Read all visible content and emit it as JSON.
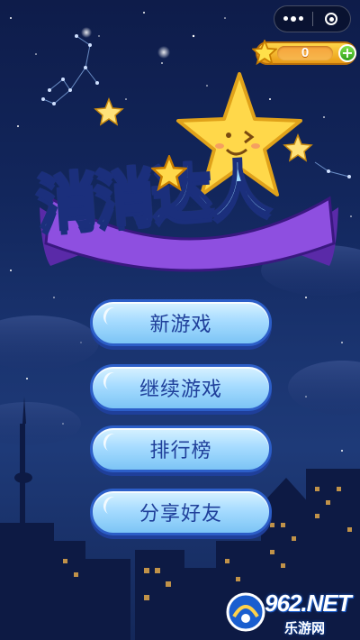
{
  "capsule": {
    "more_icon": "more-dots-icon",
    "close_icon": "close-circle-icon"
  },
  "score": {
    "value": "0",
    "star_icon": "star-icon",
    "plus_label": "+"
  },
  "title": {
    "text": "消消达人",
    "mascot_icon": "smiling-star-icon"
  },
  "menu": {
    "new_game": "新游戏",
    "continue_game": "继续游戏",
    "leaderboard": "排行榜",
    "share": "分享好友"
  },
  "watermark": {
    "brand": "962.NET",
    "site": "乐游网"
  },
  "colors": {
    "button_border": "#2c5ec8",
    "button_text": "#1f3f9a",
    "score_gold": "#ffd64a",
    "sky_top": "#0e1c4a"
  }
}
